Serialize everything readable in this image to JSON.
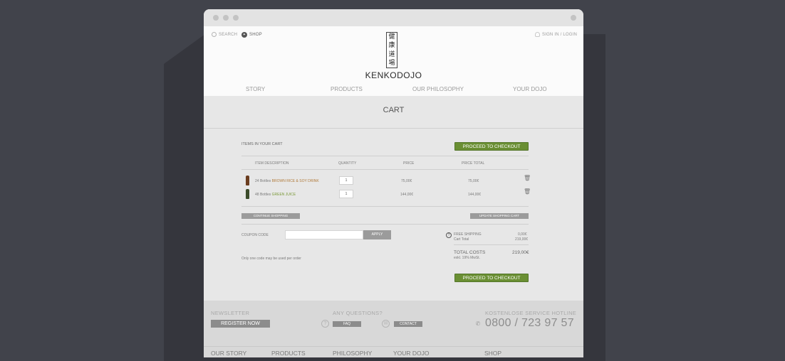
{
  "header": {
    "search_label": "SEARCH",
    "shop_label": "SHOP",
    "signin_label": "SIGN IN / LOGIN",
    "logo_kanji": [
      "健",
      "康",
      "道",
      "場"
    ],
    "logo_text": "KENKODOJO"
  },
  "nav": [
    "STORY",
    "PRODUCTS",
    "OUR PHILOSOPHY",
    "YOUR DOJO"
  ],
  "cart": {
    "title": "CART",
    "items_heading": "ITEMS IN YOUR CART",
    "checkout_label": "PROCEED TO CHECKOUT",
    "columns": [
      "ITEM DESCRIPTION",
      "QUANTITY",
      "PRICE",
      "PRICE TOTAL"
    ],
    "items": [
      {
        "qty_prefix": "24 Bottles",
        "name": "BROWN RICE & SOY DRINK",
        "quantity": "1",
        "price": "75,00€",
        "total": "75,00€"
      },
      {
        "qty_prefix": "48 Bottles",
        "name": "GREEN JUICE",
        "quantity": "1",
        "price": "144,00€",
        "total": "144,00€"
      }
    ],
    "continue_label": "CONTINUE SHOPPING",
    "update_label": "UPDATE SHOPPING CART",
    "coupon_label": "COUPON CODE",
    "coupon_value": "",
    "apply_label": "APPLY",
    "coupon_note": "Only one code may be used per order",
    "free_shipping_label": "FREE SHIPPING",
    "free_shipping_value": "0,00€",
    "cart_total_label": "Cart Total",
    "cart_total_value": "219,00€",
    "total_costs_label": "TOTAL COSTS",
    "total_costs_value": "219,00€",
    "vat_note": "exkl. 19% MwSt."
  },
  "footer": {
    "newsletter_heading": "NEWSLETTER",
    "register_label": "REGISTER NOW",
    "questions_heading": "ANY QUESTIONS?",
    "faq_label": "FAQ",
    "contact_label": "CONTACT",
    "hotline_heading": "KOSTENLOSE SERVICE HOTLINE",
    "hotline_number": "0800 / 723 97 57",
    "nav": [
      "OUR STORY",
      "PRODUCTS",
      "PHILOSOPHY",
      "YOUR DOJO",
      "SHOP"
    ]
  },
  "colors": {
    "accent_green": "#6a8f33",
    "product_brown": "#b07a3a",
    "product_green": "#7c9a3b",
    "background": "#41434b"
  }
}
